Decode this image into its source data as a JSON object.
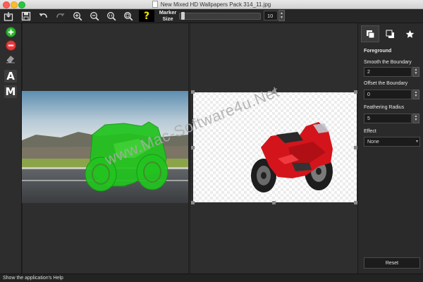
{
  "window": {
    "title": "New Mixed HD Wallpapers Pack 314_11.jpg"
  },
  "toolbar": {
    "marker_label_line1": "Marker",
    "marker_label_line2": "Size",
    "marker_size": "10",
    "marker_slider_fraction": 0.02,
    "help_label": "?"
  },
  "left_tools": {
    "text_tool_label": "A",
    "mask_tool_label": "M"
  },
  "props": {
    "section_title": "Foreground",
    "smooth_label": "Smooth the Boundary",
    "smooth_value": "2",
    "offset_label": "Offset the Boundary",
    "offset_value": "0",
    "feather_label": "Feathering Radius",
    "feather_value": "5",
    "effect_label": "Effect",
    "effect_value": "None",
    "reset_label": "Reset"
  },
  "watermark": {
    "text": "www.Mac-Software4u.Net"
  },
  "status": {
    "text": "Show the application's Help"
  }
}
